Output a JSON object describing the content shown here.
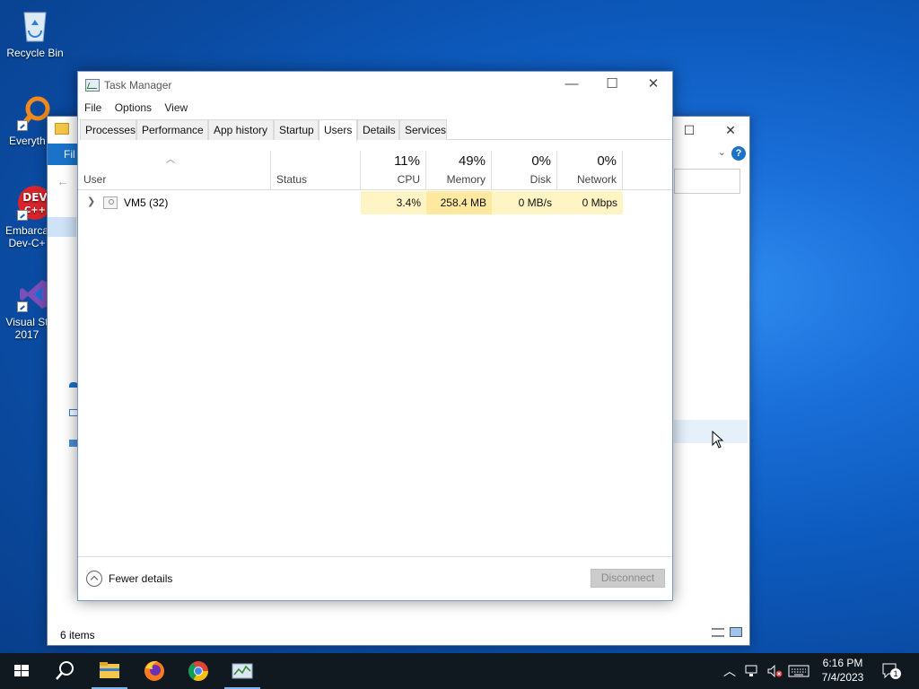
{
  "desktop": {
    "icons": [
      {
        "label": "Recycle Bin"
      },
      {
        "label": "Everyth"
      },
      {
        "label": "Embarca Dev-C+"
      },
      {
        "label": "Visual St 2017"
      }
    ]
  },
  "explorer": {
    "ribbon_file": "Fil",
    "status_items": "6 items",
    "help": "?"
  },
  "task_manager": {
    "title": "Task Manager",
    "window_buttons": {
      "minimize": "—",
      "maximize": "☐",
      "close": "✕"
    },
    "menu": [
      "File",
      "Options",
      "View"
    ],
    "tabs": [
      "Processes",
      "Performance",
      "App history",
      "Startup",
      "Users",
      "Details",
      "Services"
    ],
    "active_tab": "Users",
    "columns": {
      "user": "User",
      "status": "Status",
      "cpu": {
        "pct": "11%",
        "name": "CPU"
      },
      "memory": {
        "pct": "49%",
        "name": "Memory"
      },
      "disk": {
        "pct": "0%",
        "name": "Disk"
      },
      "network": {
        "pct": "0%",
        "name": "Network"
      }
    },
    "rows": [
      {
        "user": "VM5 (32)",
        "status": "",
        "cpu": "3.4%",
        "memory": "258.4 MB",
        "disk": "0 MB/s",
        "network": "0 Mbps"
      }
    ],
    "heat_colors": {
      "cpu": "#fff4c4",
      "memory": "#ffe8a0",
      "disk": "#fff4c4",
      "network": "#fff4c4"
    },
    "footer": {
      "fewer_details": "Fewer details",
      "disconnect": "Disconnect"
    }
  },
  "taskbar": {
    "apps": [
      "start-icon",
      "search-icon",
      "file-explorer-icon",
      "firefox-icon",
      "chrome-icon",
      "task-manager-icon"
    ],
    "clock": {
      "time": "6:16 PM",
      "date": "7/4/2023"
    },
    "notification_count": "1"
  }
}
